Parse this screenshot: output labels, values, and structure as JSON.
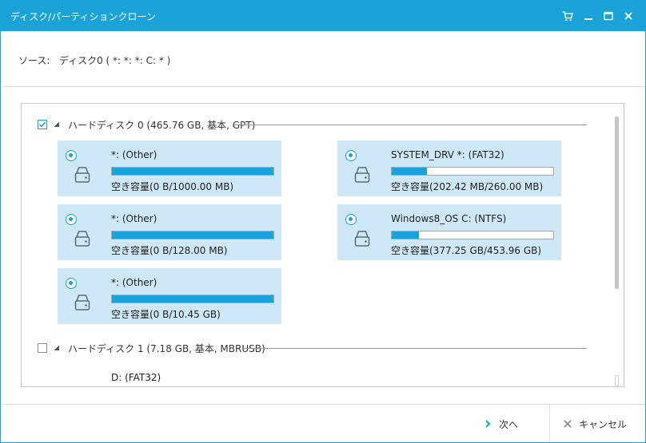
{
  "window": {
    "title": "ディスク/パーティションクローン"
  },
  "source": {
    "label": "ソース:",
    "value": "ディスク0 ( *: *: *: C: * )"
  },
  "disks": [
    {
      "label": "ハードディスク 0 (465.76 GB, 基本, GPT)",
      "checked": true,
      "partitions": [
        {
          "name": "*: (Other)",
          "free": "空き容量(0 B/1000.00 MB)",
          "used_fraction": 1.0
        },
        {
          "name": "SYSTEM_DRV *: (FAT32)",
          "free": "空き容量(202.42 MB/260.00 MB)",
          "used_fraction": 0.22
        },
        {
          "name": "*: (Other)",
          "free": "空き容量(0 B/128.00 MB)",
          "used_fraction": 1.0
        },
        {
          "name": "Windows8_OS C: (NTFS)",
          "free": "空き容量(377.25 GB/453.96 GB)",
          "used_fraction": 0.17
        },
        {
          "name": "*: (Other)",
          "free": "空き容量(0 B/10.45 GB)",
          "used_fraction": 1.0
        }
      ]
    },
    {
      "label": "ハードディスク 1 (7.18 GB, 基本, MBRUSB)",
      "checked": false,
      "partitions": [
        {
          "name": "D: (FAT32)"
        }
      ]
    }
  ],
  "footer": {
    "next_label": "次へ",
    "cancel_label": "キャンセル"
  },
  "colors": {
    "accent": "#1aa3d9",
    "partition_bg": "#cfe8f8"
  }
}
